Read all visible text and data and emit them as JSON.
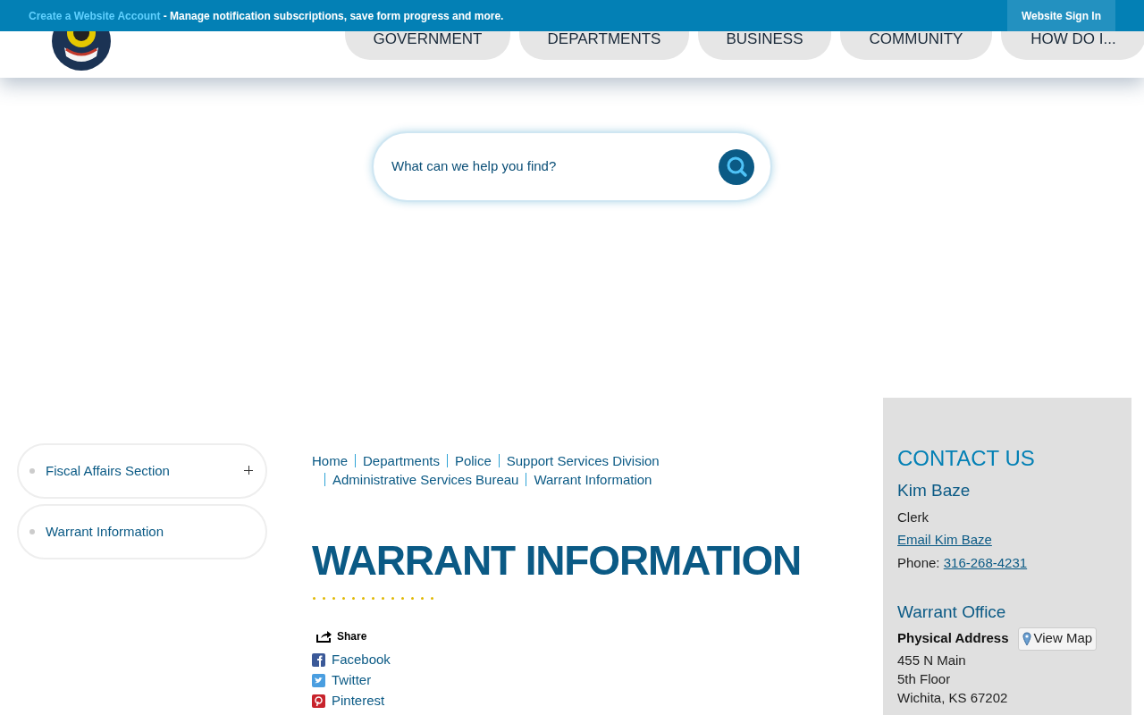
{
  "top_bar": {
    "link": "Create a Website Account",
    "text": " - Manage notification subscriptions, save form progress and more.",
    "sign_in": "Website Sign In"
  },
  "nav": [
    "GOVERNMENT",
    "DEPARTMENTS",
    "BUSINESS",
    "COMMUNITY",
    "HOW DO I..."
  ],
  "search": {
    "placeholder": "What can we help you find?"
  },
  "sidebar": {
    "items": [
      {
        "label": "Fiscal Affairs Section",
        "expandable": true
      },
      {
        "label": "Warrant Information",
        "expandable": false
      }
    ]
  },
  "breadcrumbs": [
    [
      "Home",
      "Departments",
      "Police",
      "Support Services Division"
    ],
    [
      "Administrative Services Bureau",
      "Warrant Information"
    ]
  ],
  "title": "WARRANT INFORMATION",
  "share": {
    "label": "Share",
    "links": [
      {
        "kind": "facebook",
        "label": "Facebook"
      },
      {
        "kind": "twitter",
        "label": "Twitter"
      },
      {
        "kind": "pinterest",
        "label": "Pinterest"
      }
    ]
  },
  "contact": {
    "heading": "CONTACT US",
    "name": "Kim Baze",
    "role": "Clerk",
    "email": "Email Kim Baze",
    "phone_label": "Phone: ",
    "phone": "316-268-4231",
    "office": "Warrant Office",
    "address_label": "Physical Address",
    "map_button": "View Map",
    "address": [
      "455 N Main",
      "5th Floor",
      "Wichita, KS 67202"
    ]
  }
}
